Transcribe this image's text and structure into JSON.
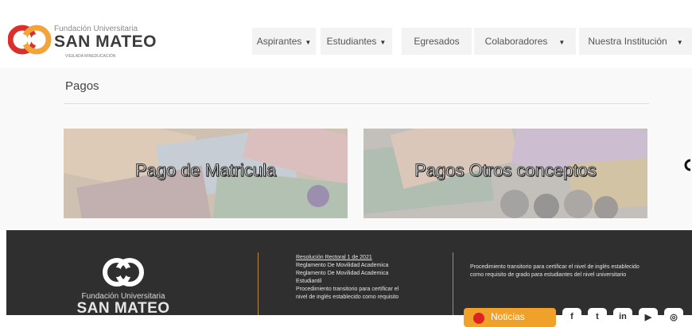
{
  "header": {
    "logo": {
      "line1": "Fundación Universitaria",
      "line2": "SAN MATEO",
      "line3": "VIGILADA MINEDUCACIÓN"
    },
    "nav": [
      {
        "label": "Aspirantes",
        "has_dropdown": true
      },
      {
        "label": "Estudiantes",
        "has_dropdown": true
      },
      {
        "label": "Egresados",
        "has_dropdown": false
      },
      {
        "label": "Colaboradores",
        "has_dropdown": true
      },
      {
        "label": "Nuestra Institución",
        "has_dropdown": true
      }
    ],
    "caret_glyph": "▼"
  },
  "page": {
    "title": "Pagos",
    "cards": [
      {
        "label": "Pago de Matricula"
      },
      {
        "label": "Pagos Otros conceptos"
      }
    ]
  },
  "footer": {
    "logo": {
      "line1": "Fundación Universitaria",
      "line2": "SAN MATEO"
    },
    "links": [
      "Resolución Rectoral 1 de 2021",
      "Reglamento De Movilidad Academica",
      "Reglamento De Movilidad Academica",
      "Estudiantil",
      "Procedimiento transitorio para certificar el",
      "nivel de inglés establecido como requisito"
    ],
    "notice": "Procedimiento transitorio para certificar el nivel de inglés establecido como requisito de grado para estudiantes del nivel universitario",
    "news_label": "Noticias",
    "social": [
      {
        "icon": "facebook-icon",
        "glyph": "f"
      },
      {
        "icon": "twitter-icon",
        "glyph": "t"
      },
      {
        "icon": "linkedin-icon",
        "glyph": "in"
      },
      {
        "icon": "youtube-icon",
        "glyph": "▶"
      },
      {
        "icon": "instagram-icon",
        "glyph": "◎"
      }
    ]
  },
  "colors": {
    "accent": "#d9302b",
    "footer_bg": "#2f2f2f",
    "news_btn": "#f0a12a",
    "divider": "#b88a3e"
  }
}
